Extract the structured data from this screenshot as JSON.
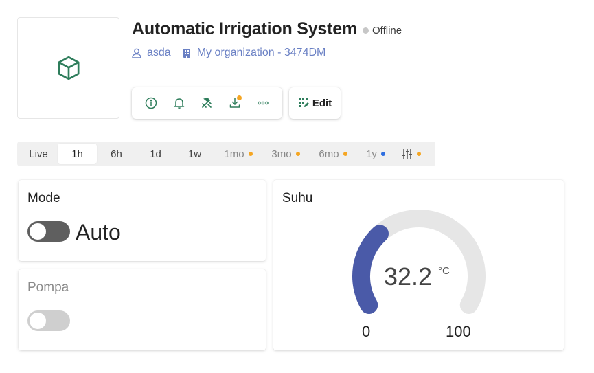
{
  "device": {
    "title": "Automatic Irrigation System",
    "status": "Offline",
    "owner": "asda",
    "organization": "My organization - 3474DM"
  },
  "toolbar": {
    "icons": [
      "info-icon",
      "bell-icon",
      "tools-icon",
      "download-icon",
      "more-icon"
    ],
    "edit_label": "Edit"
  },
  "time_ranges": [
    {
      "label": "Live",
      "active": false,
      "muted": false,
      "dot": ""
    },
    {
      "label": "1h",
      "active": true,
      "muted": false,
      "dot": ""
    },
    {
      "label": "6h",
      "active": false,
      "muted": false,
      "dot": ""
    },
    {
      "label": "1d",
      "active": false,
      "muted": false,
      "dot": ""
    },
    {
      "label": "1w",
      "active": false,
      "muted": false,
      "dot": ""
    },
    {
      "label": "1mo",
      "active": false,
      "muted": true,
      "dot": "#f5a623"
    },
    {
      "label": "3mo",
      "active": false,
      "muted": true,
      "dot": "#f5a623"
    },
    {
      "label": "6mo",
      "active": false,
      "muted": true,
      "dot": "#f5a623"
    },
    {
      "label": "1y",
      "active": false,
      "muted": true,
      "dot": "#2f6fe0"
    }
  ],
  "widgets": {
    "mode": {
      "title": "Mode",
      "value_label": "Auto",
      "on": false
    },
    "pompa": {
      "title": "Pompa",
      "on": false
    },
    "suhu": {
      "title": "Suhu",
      "value": "32.2",
      "unit": "°C",
      "min": "0",
      "max": "100",
      "fraction": 0.322
    }
  },
  "colors": {
    "accent_green": "#2e7d5b",
    "link_blue": "#6a80c4",
    "gauge_fill": "#4a5aa8",
    "gauge_track": "#e6e6e6",
    "orange_dot": "#f5a623"
  }
}
